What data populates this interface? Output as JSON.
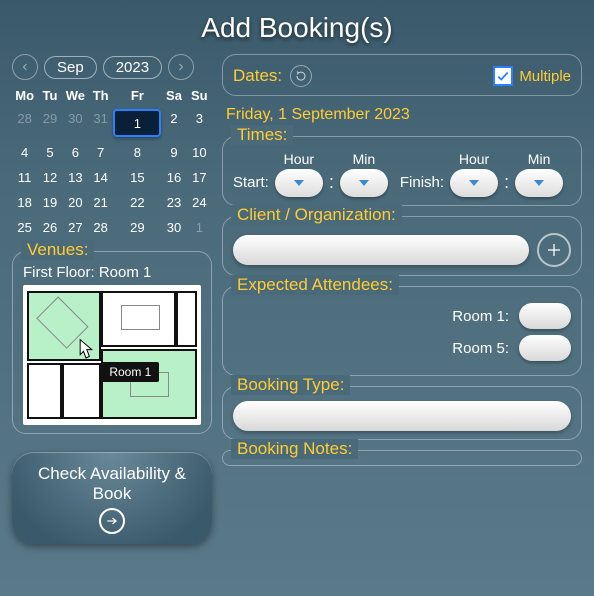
{
  "title": "Add Booking(s)",
  "calendar": {
    "month": "Sep",
    "year": "2023",
    "dow": [
      "Mo",
      "Tu",
      "We",
      "Th",
      "Fr",
      "Sa",
      "Su"
    ],
    "cells": [
      {
        "v": "28",
        "out": true
      },
      {
        "v": "29",
        "out": true
      },
      {
        "v": "30",
        "out": true
      },
      {
        "v": "31",
        "out": true
      },
      {
        "v": "1",
        "sel": true
      },
      {
        "v": "2"
      },
      {
        "v": "3"
      },
      {
        "v": "4"
      },
      {
        "v": "5"
      },
      {
        "v": "6"
      },
      {
        "v": "7"
      },
      {
        "v": "8"
      },
      {
        "v": "9"
      },
      {
        "v": "10"
      },
      {
        "v": "11"
      },
      {
        "v": "12"
      },
      {
        "v": "13"
      },
      {
        "v": "14"
      },
      {
        "v": "15"
      },
      {
        "v": "16"
      },
      {
        "v": "17"
      },
      {
        "v": "18"
      },
      {
        "v": "19"
      },
      {
        "v": "20"
      },
      {
        "v": "21"
      },
      {
        "v": "22"
      },
      {
        "v": "23"
      },
      {
        "v": "24"
      },
      {
        "v": "25"
      },
      {
        "v": "26"
      },
      {
        "v": "27"
      },
      {
        "v": "28"
      },
      {
        "v": "29"
      },
      {
        "v": "30"
      },
      {
        "v": "1",
        "out": true
      }
    ]
  },
  "venues": {
    "label": "Venues:",
    "selection": "First Floor: Room 1",
    "tooltip": "Room 1"
  },
  "action_button": "Check Availability & Book",
  "dates": {
    "label": "Dates:",
    "multiple_label": "Multiple",
    "multiple_checked": true,
    "display": "Friday, 1 September 2023"
  },
  "times": {
    "label": "Times:",
    "hour": "Hour",
    "min": "Min",
    "start": "Start:",
    "finish": "Finish:"
  },
  "client": {
    "label": "Client / Organization:",
    "value": ""
  },
  "attendees": {
    "label": "Expected Attendees:",
    "rows": [
      {
        "label": "Room 1:",
        "value": ""
      },
      {
        "label": "Room 5:",
        "value": ""
      }
    ]
  },
  "booking_type": {
    "label": "Booking Type:",
    "value": ""
  },
  "booking_notes": {
    "label": "Booking Notes:"
  }
}
